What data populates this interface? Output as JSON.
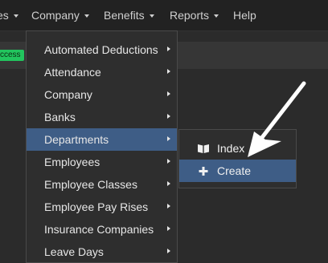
{
  "navbar": {
    "items": [
      {
        "label": "es",
        "caret": true
      },
      {
        "label": "Company",
        "caret": true
      },
      {
        "label": "Benefits",
        "caret": true
      },
      {
        "label": "Reports",
        "caret": true
      },
      {
        "label": "Help",
        "caret": false
      }
    ]
  },
  "badge": {
    "label": "ccess",
    "color": "#22c55e"
  },
  "dropdown": {
    "items": [
      {
        "label": "Automated Deductions"
      },
      {
        "label": "Attendance"
      },
      {
        "label": "Company"
      },
      {
        "label": "Banks"
      },
      {
        "label": "Departments",
        "active": true
      },
      {
        "label": "Employees"
      },
      {
        "label": "Employee Classes"
      },
      {
        "label": "Employee Pay Rises"
      },
      {
        "label": "Insurance Companies"
      },
      {
        "label": "Leave Days"
      }
    ]
  },
  "submenu": {
    "items": [
      {
        "label": "Index",
        "icon": "book-icon"
      },
      {
        "label": "Create",
        "icon": "plus-icon",
        "active": true
      }
    ]
  },
  "colors": {
    "highlight": "#3e5d86",
    "annotation": "#ffffff"
  }
}
